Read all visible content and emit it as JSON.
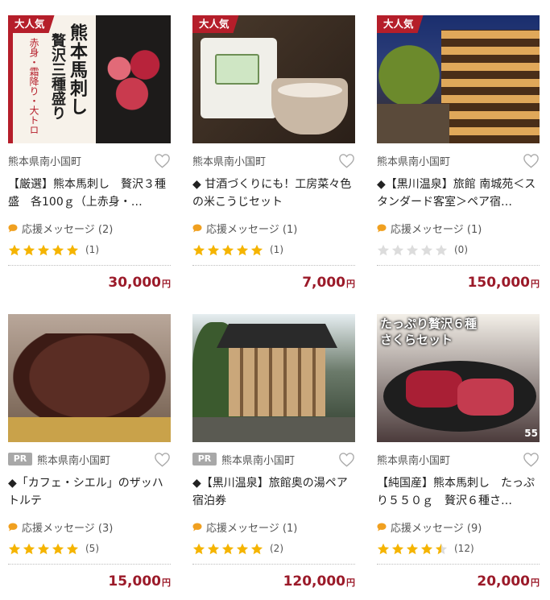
{
  "colors": {
    "badge_red": "#b51e2a",
    "price_red": "#9b1a29",
    "star_gold": "#f5b400",
    "star_empty": "#dcdcdc",
    "bubble": "#f0a020"
  },
  "items": [
    {
      "badge": "大人気",
      "pr": "",
      "location": "熊本県南小国町",
      "title": "【厳選】熊本馬刺し　贅沢３種盛　各100ｇ（上赤身・…",
      "message": "応援メッセージ (2)",
      "rating": 5,
      "rating_count": "(1)",
      "price": "30,000",
      "yen": "円",
      "image_text": [
        "熊本馬刺し",
        "贅沢三種盛り",
        "赤身・霜降り・大トロ"
      ]
    },
    {
      "badge": "大人気",
      "pr": "",
      "location": "熊本県南小国町",
      "title": "◆ 甘酒づくりにも！工房菜々色の米こうじセット",
      "message": "応援メッセージ (1)",
      "rating": 5,
      "rating_count": "(1)",
      "price": "7,000",
      "yen": "円"
    },
    {
      "badge": "大人気",
      "pr": "",
      "location": "熊本県南小国町",
      "title": "◆【黒川温泉】旅館 南城苑＜スタンダード客室＞ペア宿…",
      "message": "応援メッセージ (1)",
      "rating": 0,
      "rating_count": "(0)",
      "price": "150,000",
      "yen": "円"
    },
    {
      "badge": "",
      "pr": "PR",
      "location": "熊本県南小国町",
      "title": "◆「カフェ・シエル」のザッハトルテ",
      "message": "応援メッセージ (3)",
      "rating": 5,
      "rating_count": "(5)",
      "price": "15,000",
      "yen": "円"
    },
    {
      "badge": "",
      "pr": "PR",
      "location": "熊本県南小国町",
      "title": "◆【黒川温泉】旅館奥の湯ペア宿泊券",
      "message": "応援メッセージ (1)",
      "rating": 5,
      "rating_count": "(2)",
      "price": "120,000",
      "yen": "円"
    },
    {
      "badge": "",
      "pr": "",
      "location": "熊本県南小国町",
      "title": "【純国産】熊本馬刺し　たっぷり５５０ｇ　贅沢６種さ…",
      "message": "応援メッセージ (9)",
      "rating": 4.5,
      "rating_count": "(12)",
      "price": "20,000",
      "yen": "円",
      "image_text": [
        "たっぷり贅沢６種",
        "さくらセット",
        "55"
      ]
    }
  ]
}
